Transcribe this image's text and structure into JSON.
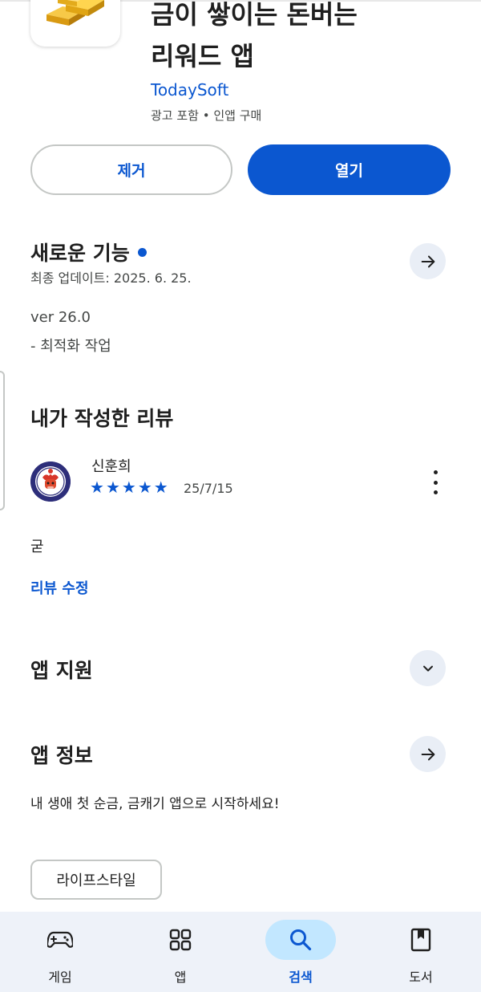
{
  "app": {
    "title_line1": "금이 쌓이는 돈버는",
    "title_line2": "리워드 앱",
    "developer": "TodaySoft",
    "meta": "광고 포함 • 인앱 구매"
  },
  "actions": {
    "remove_label": "제거",
    "open_label": "열기"
  },
  "whats_new": {
    "title": "새로운 기능",
    "updated": "최종 업데이트: 2025. 6. 25.",
    "version": "ver 26.0",
    "note": "- 최적화 작업"
  },
  "my_review": {
    "title": "내가 작성한 리뷰",
    "reviewer": "신훈희",
    "rating": 5,
    "date": "25/7/15",
    "text": "굳",
    "edit_label": "리뷰 수정"
  },
  "app_support": {
    "title": "앱 지원"
  },
  "app_info": {
    "title": "앱 정보",
    "description": "내 생애 첫 순금, 금캐기 앱으로 시작하세요!",
    "category": "라이프스타일"
  },
  "bottom_nav": {
    "items": [
      {
        "label": "게임",
        "icon": "gamepad-icon"
      },
      {
        "label": "앱",
        "icon": "apps-grid-icon"
      },
      {
        "label": "검색",
        "icon": "search-icon",
        "active": true
      },
      {
        "label": "도서",
        "icon": "bookmark-icon"
      }
    ]
  },
  "colors": {
    "accent": "#0b57d0",
    "round_button_bg": "#e9eef6",
    "nav_bg": "#eef2f9",
    "nav_active_pill": "#c2e7ff"
  }
}
